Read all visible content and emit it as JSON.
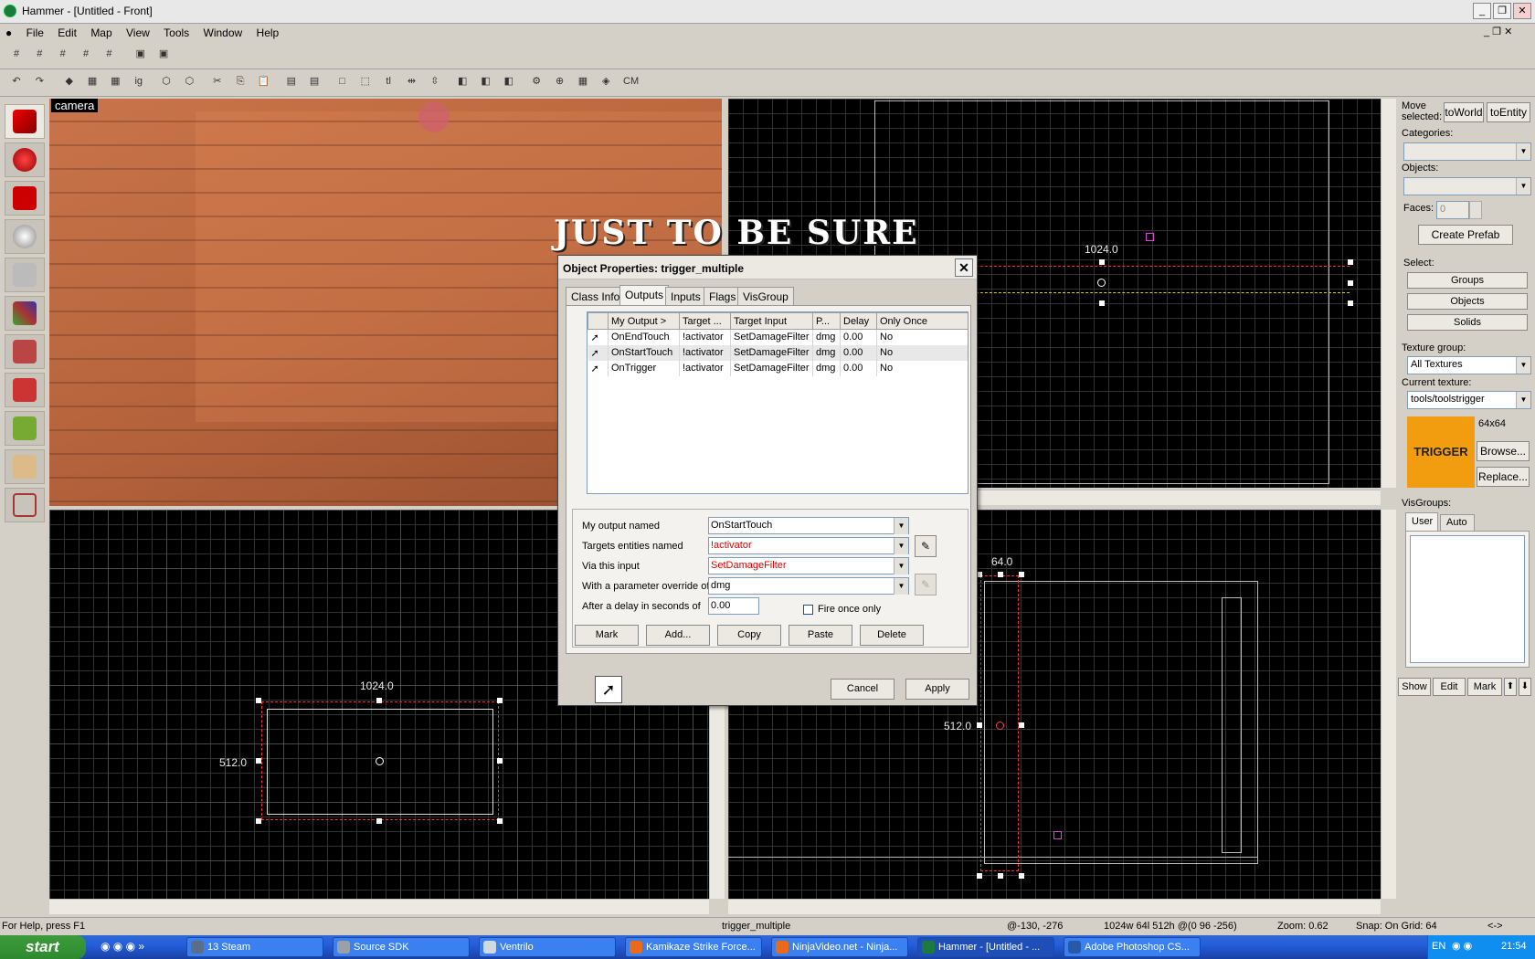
{
  "window": {
    "title": "Hammer - [Untitled - Front]"
  },
  "menu": {
    "items": [
      "File",
      "Edit",
      "Map",
      "View",
      "Tools",
      "Window",
      "Help"
    ]
  },
  "toolbar2": {
    "cm_label": "CM",
    "ig_label": "ig",
    "tl_label": "tl"
  },
  "camera": {
    "label": "camera"
  },
  "watermark": {
    "text": "JUST TO BE SURE"
  },
  "top_view": {
    "width_label": "1024.0"
  },
  "front_view": {
    "width_label": "1024.0",
    "height_label": "512.0"
  },
  "side_view": {
    "width_label": "64.0",
    "height_label": "512.0"
  },
  "right_panel": {
    "move_selected": "Move selected:",
    "to_world": "toWorld",
    "to_entity": "toEntity",
    "categories_label": "Categories:",
    "objects_label": "Objects:",
    "faces_label": "Faces:",
    "faces_value": "0",
    "create_prefab": "Create Prefab",
    "select_label": "Select:",
    "groups": "Groups",
    "objects": "Objects",
    "solids": "Solids",
    "texture_group_label": "Texture group:",
    "texture_group_value": "All Textures",
    "current_texture_label": "Current texture:",
    "current_texture_value": "tools/toolstrigger",
    "texture_size": "64x64",
    "texture_preview_text": "TRIGGER",
    "browse": "Browse...",
    "replace": "Replace...",
    "visgroups_label": "VisGroups:",
    "tab_user": "User",
    "tab_auto": "Auto",
    "show": "Show",
    "edit": "Edit",
    "mark": "Mark"
  },
  "dialog": {
    "title": "Object Properties: trigger_multiple",
    "tabs": [
      "Class Info",
      "Outputs",
      "Inputs",
      "Flags",
      "VisGroup"
    ],
    "columns": [
      "My Output  >",
      "Target ...",
      "Target Input",
      "P...",
      "Delay",
      "Only Once"
    ],
    "rows": [
      {
        "output": "OnEndTouch",
        "target": "!activator",
        "input": "SetDamageFilter",
        "param": "dmg",
        "delay": "0.00",
        "once": "No"
      },
      {
        "output": "OnStartTouch",
        "target": "!activator",
        "input": "SetDamageFilter",
        "param": "dmg",
        "delay": "0.00",
        "once": "No"
      },
      {
        "output": "OnTrigger",
        "target": "!activator",
        "input": "SetDamageFilter",
        "param": "dmg",
        "delay": "0.00",
        "once": "No"
      }
    ],
    "fields": {
      "output_label": "My output named",
      "output_value": "OnStartTouch",
      "targets_label": "Targets entities named",
      "targets_value": "!activator",
      "input_label": "Via this input",
      "input_value": "SetDamageFilter",
      "param_label": "With a parameter override of",
      "param_value": "dmg",
      "delay_label": "After a delay in seconds of",
      "delay_value": "0.00",
      "fire_once_label": "Fire once only"
    },
    "buttons": {
      "mark": "Mark",
      "add": "Add...",
      "copy": "Copy",
      "paste": "Paste",
      "delete": "Delete",
      "cancel": "Cancel",
      "apply": "Apply"
    },
    "text_red": "#e00000"
  },
  "status": {
    "help": "For Help, press F1",
    "entity": "trigger_multiple",
    "coords": "@-130, -276",
    "size": "1024w 64l 512h @(0 96 -256)",
    "zoom": "Zoom: 0.62",
    "snap": "Snap: On Grid: 64",
    "arrows": "<->"
  },
  "taskbar": {
    "start": "start",
    "tasks": [
      {
        "label": "13 Steam",
        "color": "#5a6d8a"
      },
      {
        "label": "Source SDK",
        "color": "#9aa0a8"
      },
      {
        "label": "Ventrilo",
        "color": "#d0d8e0"
      },
      {
        "label": "Kamikaze Strike Force...",
        "color": "#e86a1a"
      },
      {
        "label": "NinjaVideo.net - Ninja...",
        "color": "#e86a1a"
      },
      {
        "label": "Hammer - [Untitled - ...",
        "color": "#1c7a3c"
      },
      {
        "label": "Adobe Photoshop CS...",
        "color": "#2858a8"
      }
    ],
    "lang": "EN",
    "time": "21:54"
  }
}
